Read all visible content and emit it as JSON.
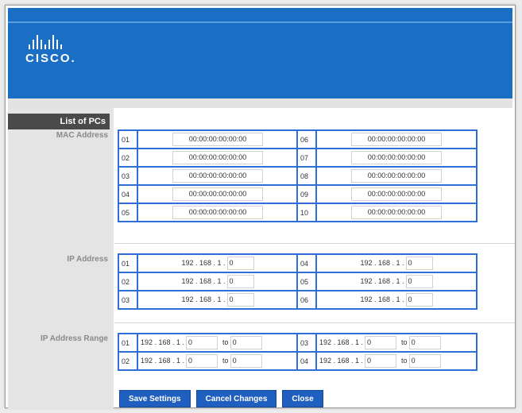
{
  "brand": {
    "logo_text": "CISCO.",
    "colors": {
      "header": "#1a6fc4",
      "button": "#1f5fbf",
      "table_border": "#2d6fd6"
    }
  },
  "section_title": "List of PCs",
  "mac": {
    "label": "MAC Address",
    "left": [
      {
        "n": "01",
        "v": "00:00:00:00:00:00"
      },
      {
        "n": "02",
        "v": "00:00:00:00:00:00"
      },
      {
        "n": "03",
        "v": "00:00:00:00:00:00"
      },
      {
        "n": "04",
        "v": "00:00:00:00:00:00"
      },
      {
        "n": "05",
        "v": "00:00:00:00:00:00"
      }
    ],
    "right": [
      {
        "n": "06",
        "v": "00:00:00:00:00:00"
      },
      {
        "n": "07",
        "v": "00:00:00:00:00:00"
      },
      {
        "n": "08",
        "v": "00:00:00:00:00:00"
      },
      {
        "n": "09",
        "v": "00:00:00:00:00:00"
      },
      {
        "n": "10",
        "v": "00:00:00:00:00:00"
      }
    ]
  },
  "ip": {
    "label": "IP Address",
    "prefix": "192 . 168 . 1 .",
    "left": [
      {
        "n": "01",
        "v": "0"
      },
      {
        "n": "02",
        "v": "0"
      },
      {
        "n": "03",
        "v": "0"
      }
    ],
    "right": [
      {
        "n": "04",
        "v": "0"
      },
      {
        "n": "05",
        "v": "0"
      },
      {
        "n": "06",
        "v": "0"
      }
    ]
  },
  "range": {
    "label": "IP Address Range",
    "prefix": "192 . 168 . 1 .",
    "to": "to",
    "left": [
      {
        "n": "01",
        "from": "0",
        "to": "0"
      },
      {
        "n": "02",
        "from": "0",
        "to": "0"
      }
    ],
    "right": [
      {
        "n": "03",
        "from": "0",
        "to": "0"
      },
      {
        "n": "04",
        "from": "0",
        "to": "0"
      }
    ]
  },
  "buttons": {
    "save": "Save Settings",
    "cancel": "Cancel Changes",
    "close": "Close"
  }
}
